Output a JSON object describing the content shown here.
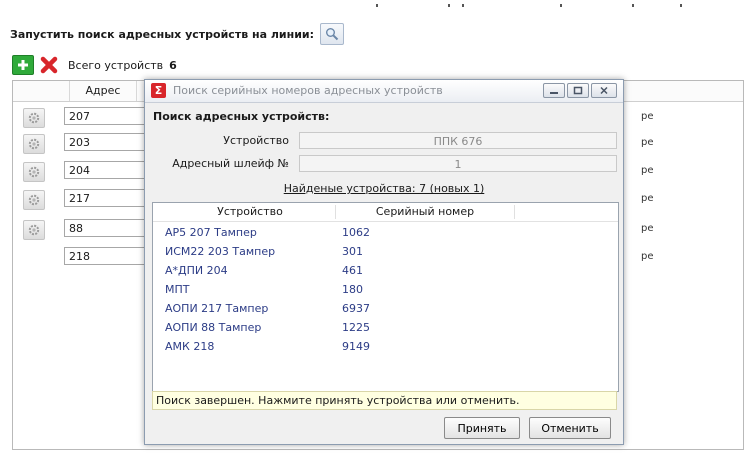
{
  "search_bar": {
    "label": "Запустить поиск адресных устройств на линии:"
  },
  "toolbar": {
    "count_label": "Всего устройств",
    "count_value": "6"
  },
  "grid": {
    "header_address": "Адрес",
    "rows": [
      {
        "address": "207",
        "tail": "ре",
        "has_icon": true
      },
      {
        "address": "203",
        "tail": "ре",
        "has_icon": true
      },
      {
        "address": "204",
        "tail": "ре",
        "has_icon": true
      },
      {
        "address": "217",
        "tail": "ре",
        "has_icon": true
      },
      {
        "address": "88",
        "tail": "ре",
        "has_icon": true
      },
      {
        "address": "218",
        "tail": "ре",
        "has_icon": false
      }
    ]
  },
  "dialog": {
    "title": "Поиск серийных номеров адресных устройств",
    "section_title": "Поиск адресных устройств:",
    "device_label": "Устройство",
    "device_value": "ППК 676",
    "loop_label": "Адресный шлейф №",
    "loop_value": "1",
    "found_text": "Найденые устройства: 7 (новых 1)",
    "list_headers": {
      "device": "Устройство",
      "serial": "Серийный номер"
    },
    "list_rows": [
      {
        "device": "АР5 207 Тампер",
        "serial": "1062"
      },
      {
        "device": "ИСМ22 203 Тампер",
        "serial": "301"
      },
      {
        "device": "А*ДПИ 204",
        "serial": "461"
      },
      {
        "device": "МПТ",
        "serial": "180"
      },
      {
        "device": "АОПИ 217 Тампер",
        "serial": "6937"
      },
      {
        "device": "АОПИ 88 Тампер",
        "serial": "1225"
      },
      {
        "device": "АМК 218",
        "serial": "9149"
      }
    ],
    "status": "Поиск завершен. Нажмите принять устройства или отменить.",
    "accept_label": "Принять",
    "cancel_label": "Отменить"
  },
  "colors": {
    "list_text": "#2c3c86",
    "status_bg": "#ffffe1",
    "add_green": "#2faa3a",
    "delete_red": "#d8262b"
  },
  "icons": {
    "search_button": "magnifier-icon",
    "add": "plus-icon",
    "delete": "x-icon",
    "row": "gear-icon",
    "app": "sigma-icon",
    "window": [
      "minimize-icon",
      "maximize-icon",
      "close-icon"
    ]
  }
}
